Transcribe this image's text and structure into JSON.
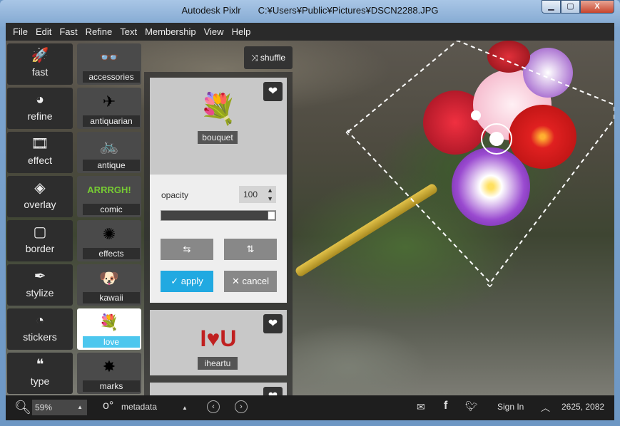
{
  "window": {
    "app": "Autodesk Pixlr",
    "path": "C:¥Users¥Public¥Pictures¥DSCN2288.JPG",
    "minimize": "▁",
    "maximize": "▢",
    "close": "X"
  },
  "menu": [
    "File",
    "Edit",
    "Fast",
    "Refine",
    "Text",
    "Membership",
    "View",
    "Help"
  ],
  "tools": [
    {
      "label": "fast",
      "icon": "rocket-icon",
      "glyph": "🚀"
    },
    {
      "label": "refine",
      "icon": "refine-icon",
      "glyph": "◕"
    },
    {
      "label": "effect",
      "icon": "film-icon",
      "glyph": "🎞"
    },
    {
      "label": "overlay",
      "icon": "layers-icon",
      "glyph": "◈"
    },
    {
      "label": "border",
      "icon": "border-icon",
      "glyph": "▢"
    },
    {
      "label": "stylize",
      "icon": "feather-icon",
      "glyph": "✒"
    },
    {
      "label": "stickers",
      "icon": "sticker-icon",
      "glyph": "◔"
    },
    {
      "label": "type",
      "icon": "quote-icon",
      "glyph": "❝"
    }
  ],
  "sticker_categories": [
    {
      "label": "accessories",
      "art": "👓"
    },
    {
      "label": "antiquarian",
      "art": "✈"
    },
    {
      "label": "antique",
      "art": "🚲"
    },
    {
      "label": "comic",
      "art": "ARRRGH!"
    },
    {
      "label": "effects",
      "art": "✺"
    },
    {
      "label": "kawaii",
      "art": "🐶"
    },
    {
      "label": "love",
      "art": "💐",
      "selected": true
    },
    {
      "label": "marks",
      "art": "✸"
    }
  ],
  "shuffle_label": "shuffle",
  "stickers": [
    {
      "label": "bouquet",
      "art": "💐"
    },
    {
      "label": "iheartu",
      "art": "I♥U"
    },
    {
      "label": "",
      "art": "❤"
    }
  ],
  "controls": {
    "opacity_label": "opacity",
    "opacity_value": "100",
    "opacity": 100,
    "flip_h": "⇆",
    "flip_v": "⇅",
    "apply": "apply",
    "cancel": "cancel"
  },
  "status": {
    "zoom": "59%",
    "metadata": "metadata",
    "sign_in": "Sign In",
    "coords": "2625, 2082"
  },
  "colors": {
    "accent": "#21a9e1",
    "selected_label": "#4dc7ee"
  }
}
